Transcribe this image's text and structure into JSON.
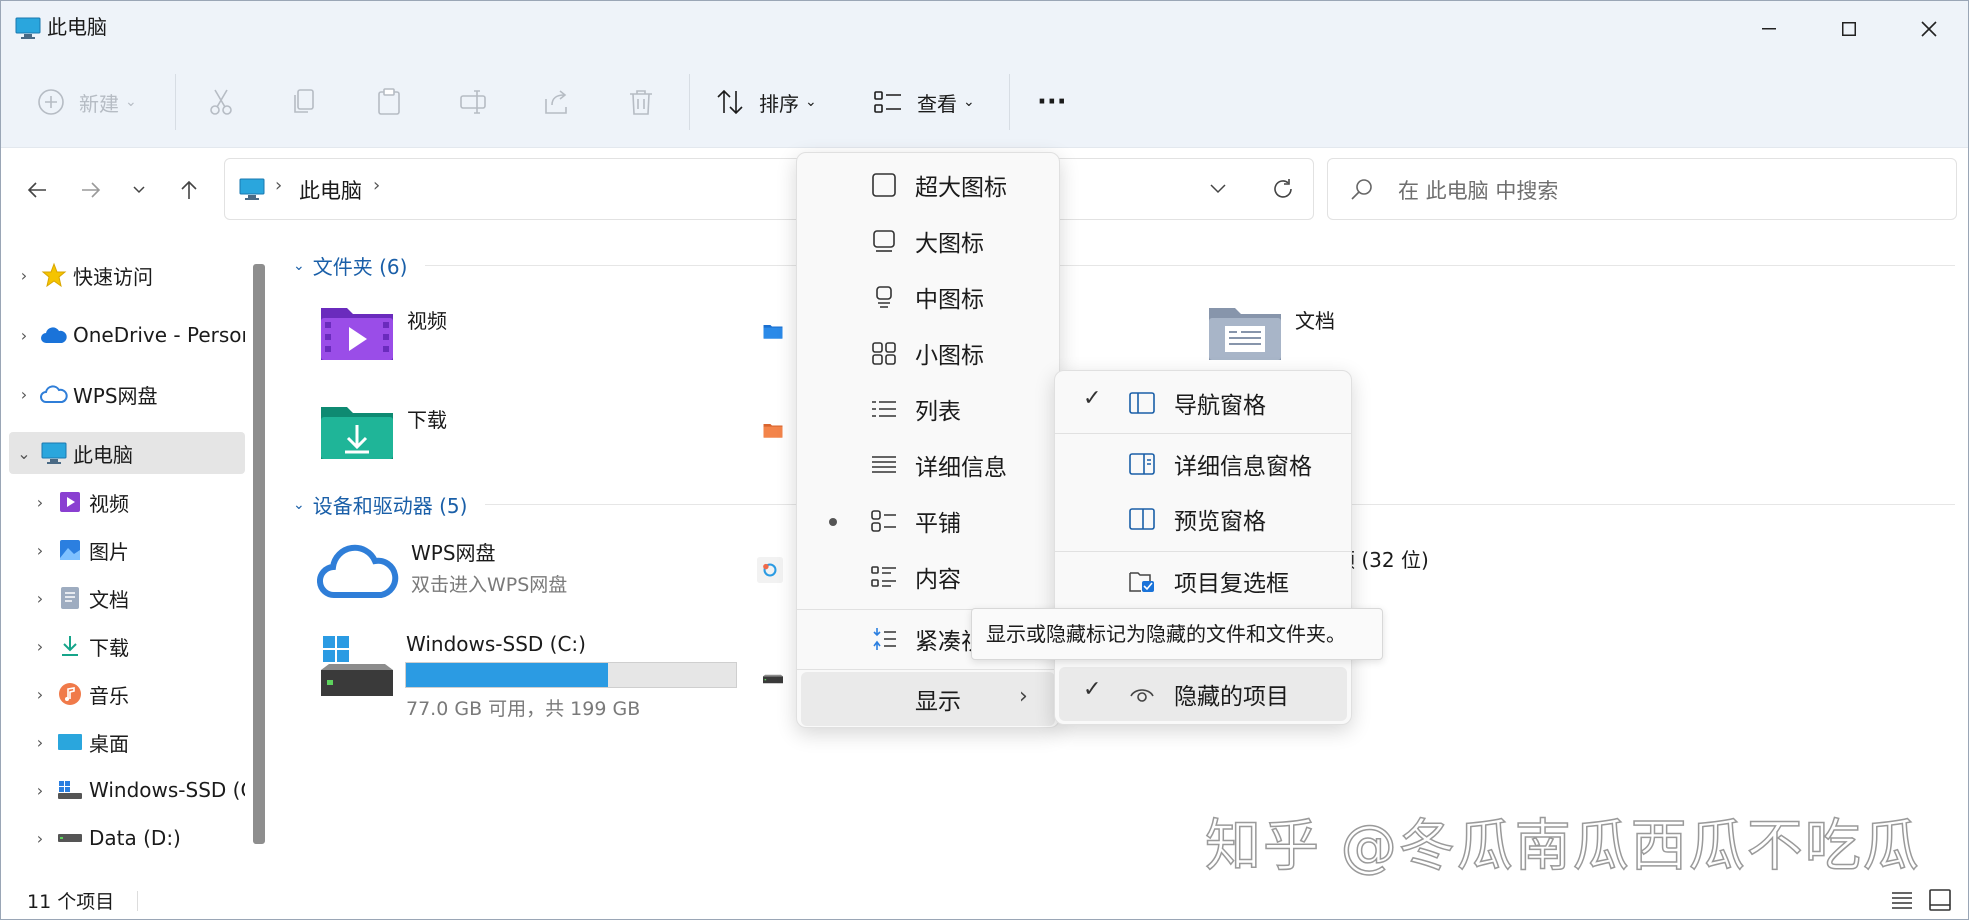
{
  "window": {
    "title": "此电脑"
  },
  "toolbar": {
    "new_label": "新建",
    "sort_label": "排序",
    "view_label": "查看",
    "more_label": "···"
  },
  "address": {
    "crumb": "此电脑",
    "search_placeholder": "在 此电脑 中搜索"
  },
  "sidebar": {
    "items": [
      {
        "label": "快速访问"
      },
      {
        "label": "OneDrive - Personal"
      },
      {
        "label": "WPS网盘"
      },
      {
        "label": "此电脑"
      },
      {
        "label": "视频"
      },
      {
        "label": "图片"
      },
      {
        "label": "文档"
      },
      {
        "label": "下载"
      },
      {
        "label": "音乐"
      },
      {
        "label": "桌面"
      },
      {
        "label": "Windows-SSD (C:)"
      },
      {
        "label": "Data (D:)"
      }
    ]
  },
  "content": {
    "folders_header": "文件夹 (6)",
    "folders": [
      {
        "name": "视频"
      },
      {
        "name": "文档"
      },
      {
        "name": "下载"
      }
    ],
    "devices_header": "设备和驱动器 (5)",
    "wps": {
      "name": "WPS网盘",
      "sub": "双击进入WPS网盘"
    },
    "drive_c": {
      "name": "Windows-SSD (C:)",
      "sub": "77.0 GB 可用，共 199 GB",
      "used_fraction": 0.613
    },
    "partial_label": "频 (32 位)"
  },
  "status": {
    "count": "11 个项目"
  },
  "view_menu": {
    "items": [
      {
        "label": "超大图标"
      },
      {
        "label": "大图标"
      },
      {
        "label": "中图标"
      },
      {
        "label": "小图标"
      },
      {
        "label": "列表"
      },
      {
        "label": "详细信息"
      },
      {
        "label": "平铺",
        "selected": true
      },
      {
        "label": "内容"
      },
      {
        "label": "紧凑视图"
      },
      {
        "label": "显示"
      }
    ]
  },
  "show_submenu": {
    "items": [
      {
        "label": "导航窗格",
        "checked": true
      },
      {
        "label": "详细信息窗格",
        "checked": false
      },
      {
        "label": "预览窗格",
        "checked": false
      },
      {
        "label": "项目复选框",
        "checked": false
      },
      {
        "label": "隐藏的项目",
        "checked": true
      }
    ]
  },
  "tooltip": {
    "text": "显示或隐藏标记为隐藏的文件和文件夹。"
  },
  "watermark": {
    "text": "知乎 @冬瓜南瓜西瓜不吃瓜"
  },
  "colors": {
    "accent": "#2b9be3",
    "link": "#1a5fa8"
  }
}
